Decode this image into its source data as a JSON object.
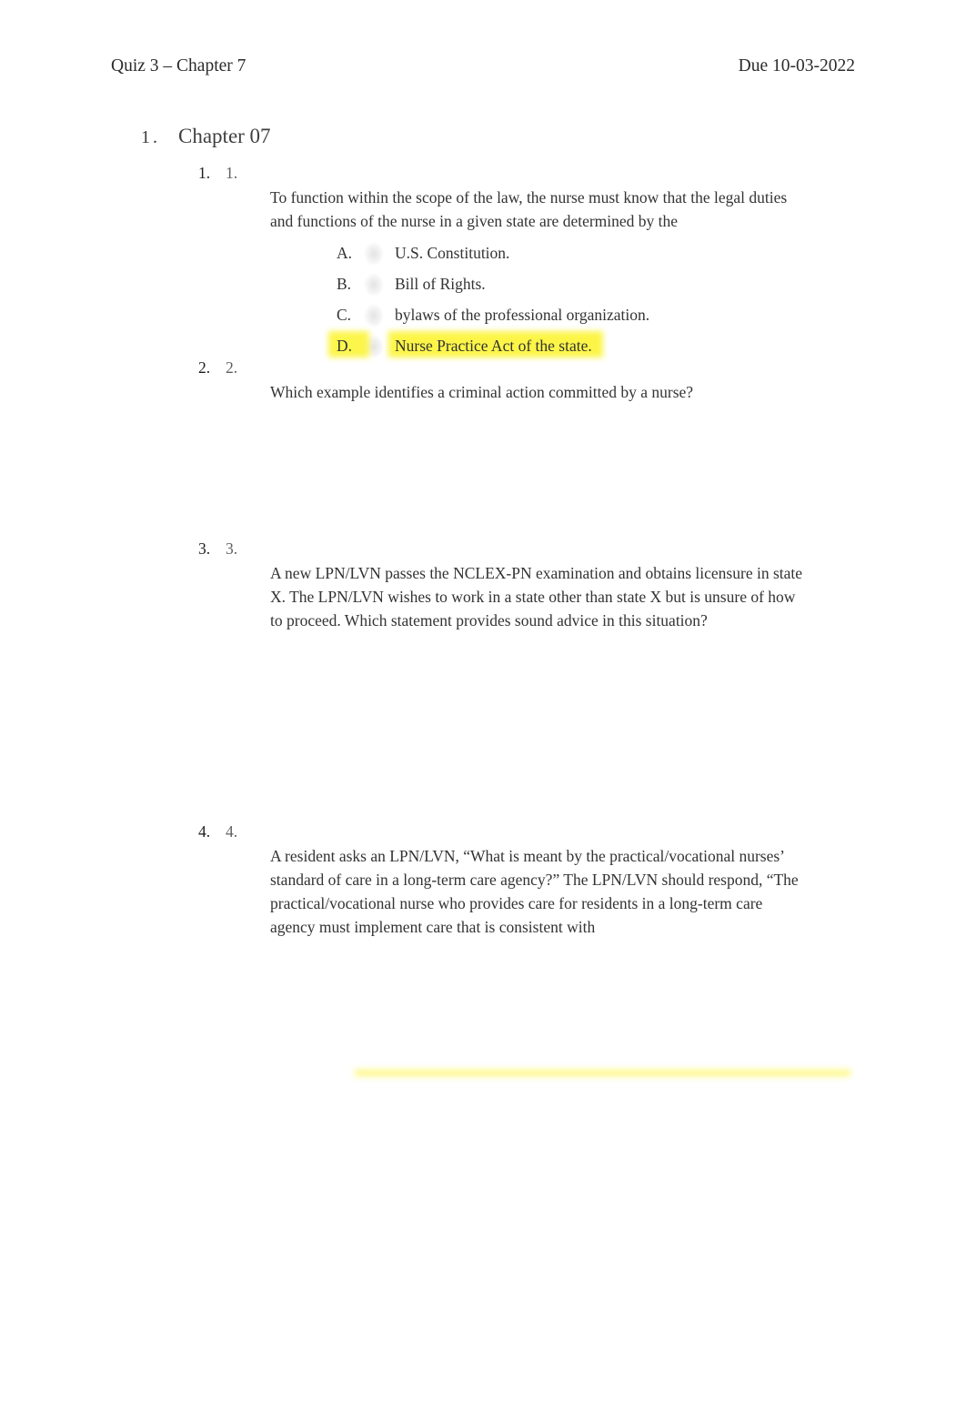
{
  "header": {
    "left": "Quiz 3 – Chapter 7",
    "right": "Due 10-03-2022"
  },
  "chapter": {
    "marker": "1.",
    "title": "Chapter 07"
  },
  "colors": {
    "highlight": "#fcf53f",
    "text": "#333333",
    "marker_muted": "#5f5f5f"
  },
  "questions": [
    {
      "outer_marker": "1.",
      "inner_marker": "1.",
      "stem": "To function within the scope of the law, the nurse must know that the legal duties and functions of the nurse in a given state are determined by the",
      "options": [
        {
          "letter": "A.",
          "text": "U.S. Constitution.",
          "highlighted": false
        },
        {
          "letter": "B.",
          "text": "Bill of Rights.",
          "highlighted": false
        },
        {
          "letter": "C.",
          "text": "bylaws of the professional organization.",
          "highlighted": false
        },
        {
          "letter": "D.",
          "text": "Nurse Practice Act of the state.",
          "highlighted": true
        }
      ]
    },
    {
      "outer_marker": "2.",
      "inner_marker": "2.",
      "stem": "Which example identifies a criminal action committed by a nurse?",
      "options": []
    },
    {
      "outer_marker": "3.",
      "inner_marker": "3.",
      "stem": "A new LPN/LVN passes the NCLEX-PN examination and obtains licensure in state X. The LPN/LVN wishes to work in a state other than state X but is unsure of how to proceed. Which statement provides sound advice in this situation?",
      "options": []
    },
    {
      "outer_marker": "4.",
      "inner_marker": "4.",
      "stem": "A resident asks an LPN/LVN, “What is meant by the practical/vocational nurses’ standard of care in a long-term care agency?” The LPN/LVN should respond, “The practical/vocational nurse who provides care for residents in a long-term care agency must implement care that is consistent with",
      "options": []
    }
  ]
}
